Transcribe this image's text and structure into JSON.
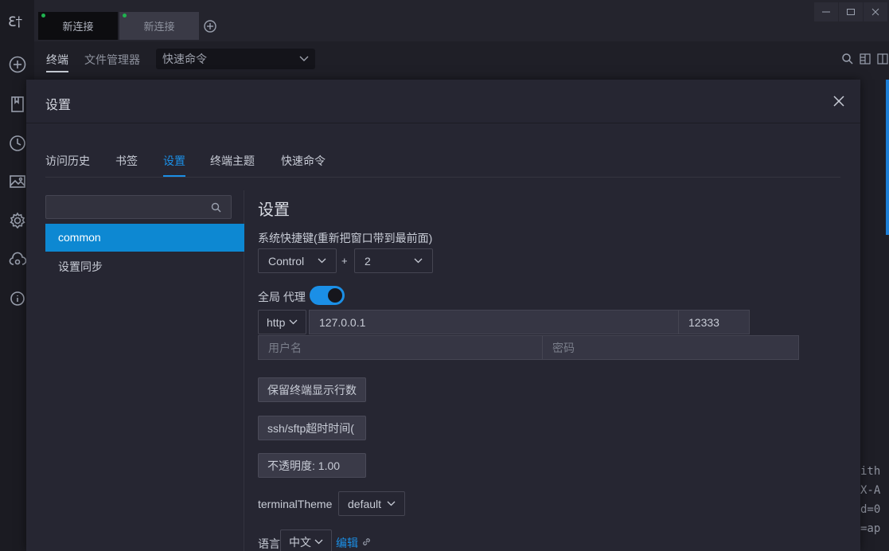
{
  "app": {
    "logo": "ℇ†"
  },
  "rail": {
    "icons": [
      "add-circle-icon",
      "bookmark-icon",
      "history-icon",
      "image-icon",
      "gear-icon",
      "cloud-sync-icon",
      "info-icon"
    ]
  },
  "tabs": {
    "items": [
      {
        "label": "新连接",
        "active": true
      },
      {
        "label": "新连接",
        "active": false
      }
    ]
  },
  "subnav": {
    "terminal": "终端",
    "file_manager": "文件管理器",
    "quick_command": "快速命令"
  },
  "terminal_text": "ith\nX-A\nd=0\n=ap",
  "modal": {
    "title": "设置",
    "tabs": [
      "访问历史",
      "书签",
      "设置",
      "终端主题",
      "快速命令"
    ],
    "active_tab": "设置",
    "sidebar": {
      "search_placeholder": "",
      "items": [
        "common",
        "设置同步"
      ],
      "active_item": "common"
    },
    "content": {
      "title": "设置",
      "hotkey_label": "系统快捷键(重新把窗口带到最前面)",
      "hotkey_modifier": "Control",
      "hotkey_plus": "+",
      "hotkey_key": "2",
      "proxy_label": "全局 代理",
      "proxy_enabled": true,
      "proxy_protocol": "http",
      "proxy_host": "127.0.0.1",
      "proxy_port": "12333",
      "username_placeholder": "用户名",
      "password_placeholder": "密码",
      "keep_lines_label": "保留终端显示行数",
      "timeout_label": "ssh/sftp超时时间(",
      "opacity_label": "不透明度: 1.00",
      "terminal_theme_label": "terminalTheme",
      "terminal_theme_value": "default",
      "language_label": "语言",
      "language_value": "中文",
      "edit_link": "编辑"
    }
  },
  "colors": {
    "accent": "#1b8fe6",
    "active_item": "#0d88d2",
    "status_dot": "#1fb34f"
  }
}
